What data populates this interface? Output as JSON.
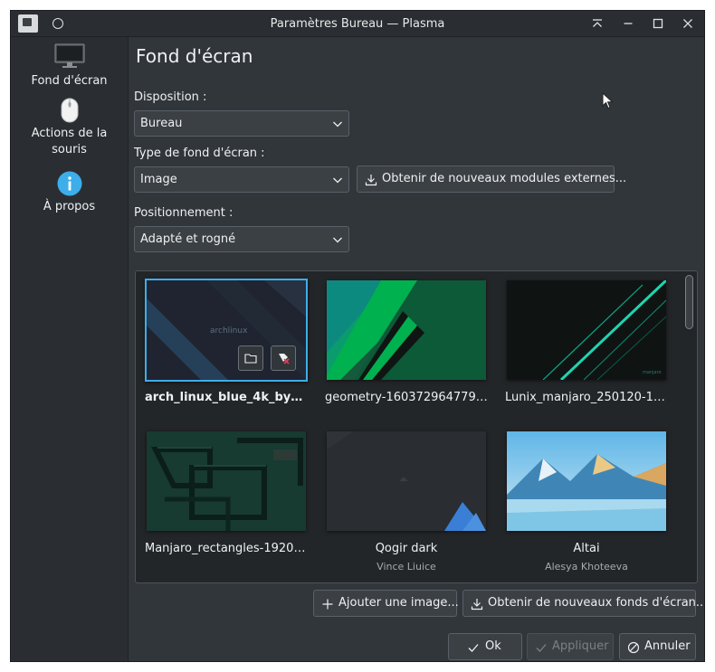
{
  "window": {
    "title": "Paramètres Bureau — Plasma"
  },
  "sidebar": {
    "items": [
      {
        "label": "Fond d'écran",
        "icon": "monitor-icon"
      },
      {
        "label": "Actions de la souris",
        "icon": "mouse-icon"
      },
      {
        "label": "À propos",
        "icon": "info-icon"
      }
    ]
  },
  "main": {
    "title": "Fond d'écran",
    "layout_label": "Disposition :",
    "layout_value": "Bureau",
    "type_label": "Type de fond d'écran :",
    "type_value": "Image",
    "get_plugins_label": "Obtenir de nouveaux modules externes...",
    "positioning_label": "Positionnement :",
    "positioning_value": "Adapté et rogné",
    "wallpapers": [
      {
        "name": "arch_linux_blue_4k_by_hy...",
        "author": "",
        "selected": true
      },
      {
        "name": "geometry-1603729647794-...",
        "author": "",
        "selected": false
      },
      {
        "name": "Lunix_manjaro_250120-192...",
        "author": "",
        "selected": false
      },
      {
        "name": "Manjaro_rectangles-1920x1...",
        "author": "",
        "selected": false
      },
      {
        "name": "Qogir dark",
        "author": "Vince Liuice",
        "selected": false
      },
      {
        "name": "Altai",
        "author": "Alesya Khoteeva",
        "selected": false
      }
    ],
    "thumb_text": {
      "arch": "archlinux",
      "lunix": "manjaro"
    },
    "add_image_label": "Ajouter une image...",
    "get_wallpapers_label": "Obtenir de nouveaux fonds d'écran..."
  },
  "footer": {
    "ok_label": "Ok",
    "apply_label": "Appliquer",
    "cancel_label": "Annuler"
  },
  "colors": {
    "accent": "#3daee9",
    "window_bg": "#31363b",
    "sidebar_bg": "#2a2e32"
  }
}
